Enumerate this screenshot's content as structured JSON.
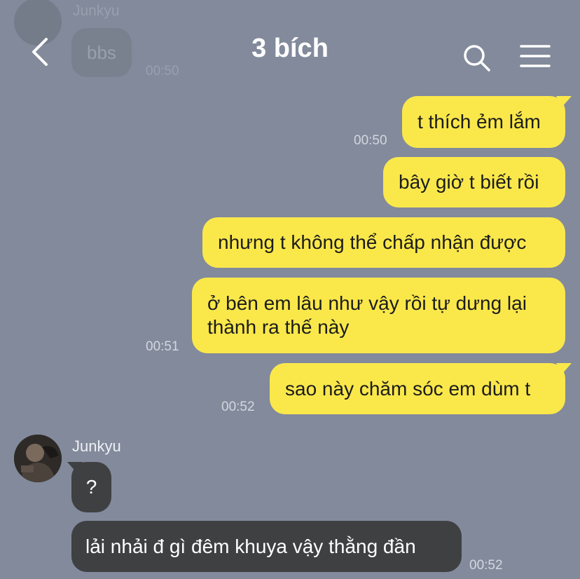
{
  "background_color": "#828a9c",
  "header": {
    "title": "3 bích",
    "back_icon": "chevron-left-icon",
    "search_icon": "search-icon",
    "menu_icon": "hamburger-menu-icon"
  },
  "ghost_message": {
    "sender": "Junkyu",
    "text": "bbs",
    "time": "00:50"
  },
  "outgoing": [
    {
      "text": "t thích ẻm lắm",
      "time": "00:50"
    },
    {
      "text": "bây giờ t biết rồi",
      "time": ""
    },
    {
      "text": "nhưng t không thể chấp nhận được",
      "time": ""
    },
    {
      "text": "ở bên em lâu như vậy rồi tự dưng lại thành ra thế này",
      "time": "00:51"
    },
    {
      "text": "sao này chăm sóc em dùm t",
      "time": "00:52"
    }
  ],
  "incoming": {
    "sender": "Junkyu",
    "messages": [
      {
        "text": "?",
        "time": ""
      },
      {
        "text": "lải nhải đ gì đêm khuya vậy thằng đần",
        "time": "00:52"
      }
    ]
  },
  "colors": {
    "outgoing_bubble": "#fae84b",
    "incoming_bubble": "#3f4042"
  }
}
